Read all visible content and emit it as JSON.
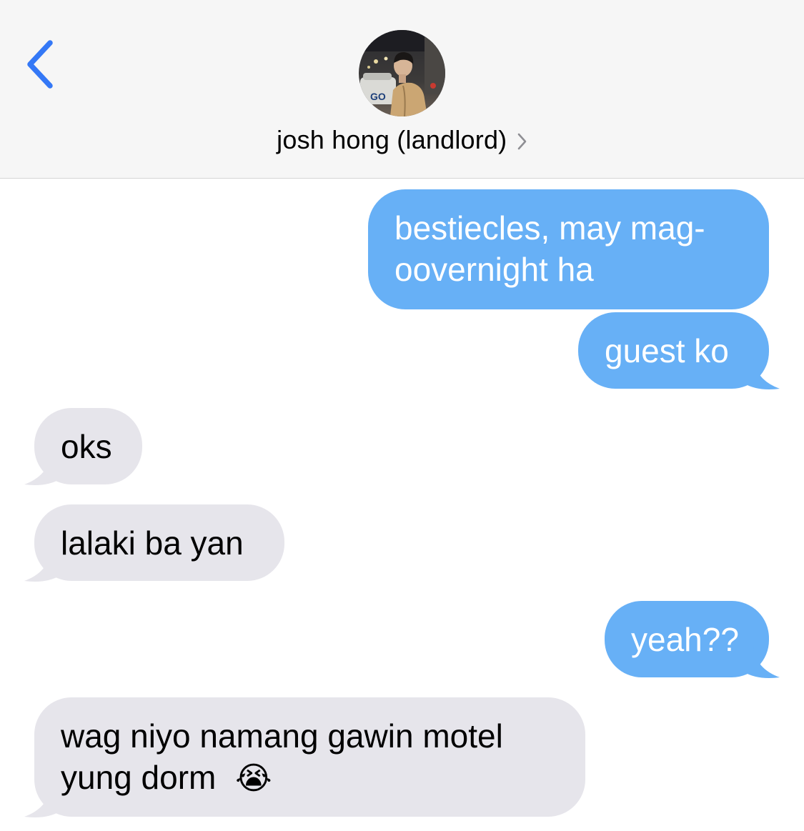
{
  "header": {
    "back_icon": "chevron-left-icon",
    "contact_name": "josh hong (landlord)",
    "contact_chevron_icon": "chevron-right-icon",
    "avatar_label": "GO"
  },
  "colors": {
    "accent": "#3478f6",
    "sent_bubble": "#67b0f6",
    "received_bubble": "#e6e5eb",
    "header_bg": "#f6f6f6"
  },
  "messages": [
    {
      "direction": "sent",
      "lines": [
        "bestiecles, may mag-",
        "oovernight ha"
      ]
    },
    {
      "direction": "sent",
      "lines": [
        "guest ko"
      ]
    },
    {
      "direction": "received",
      "lines": [
        "oks"
      ]
    },
    {
      "direction": "received",
      "lines": [
        "lalaki ba yan"
      ]
    },
    {
      "direction": "sent",
      "lines": [
        "yeah??"
      ]
    },
    {
      "direction": "received",
      "lines": [
        "wag niyo namang gawin motel",
        "yung dorm"
      ],
      "emoji": "😭"
    }
  ]
}
